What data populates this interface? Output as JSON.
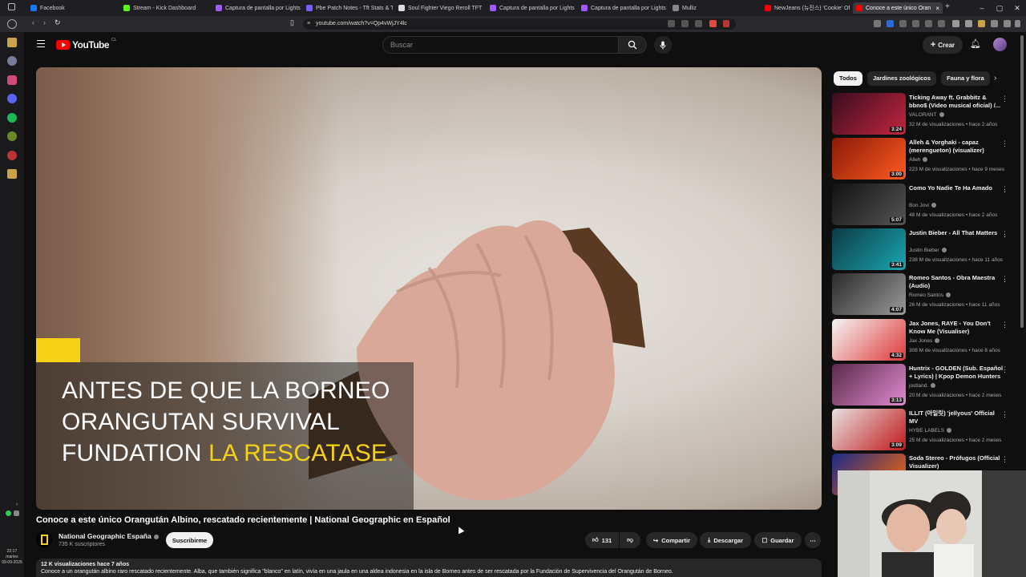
{
  "browser": {
    "tabs": [
      {
        "label": "Facebook",
        "color": "#1877f2"
      },
      {
        "label": "Stream - Kick Dashboard",
        "color": "#53fc18"
      },
      {
        "label": "Captura de pantalla por Lightshot",
        "color": "#a259ff"
      },
      {
        "label": "Pbe Patch Notes - Tft Stats & Too",
        "color": "#7b5cff"
      },
      {
        "label": "Soul Fighter Viego Reroll TFT Co",
        "color": "#dddddd"
      },
      {
        "label": "Captura de pantalla por Lightshot",
        "color": "#a259ff"
      },
      {
        "label": "Captura de pantalla por Lightshot",
        "color": "#a259ff"
      },
      {
        "label": "Mulliz",
        "color": "#888888"
      },
      {
        "label": "NewJeans (뉴진스) 'Cookie' Offici",
        "color": "#ff0000"
      },
      {
        "label": "Conoce a este único Oran",
        "color": "#ff0000",
        "active": true
      }
    ],
    "url": "youtube.com/watch?v=Qp4vWjJY4lc",
    "clock_time": "22:17",
    "clock_day": "martes",
    "clock_date": "09-09-2025"
  },
  "header": {
    "logo_text": "YouTube",
    "logo_region": "CL",
    "search_placeholder": "Buscar",
    "create_label": "Crear"
  },
  "video": {
    "caption_line1": "ANTES DE QUE LA BORNEO",
    "caption_line2": "ORANGUTAN SURVIVAL",
    "caption_line3_a": "FUNDATION ",
    "caption_line3_b": "LA RESCATASE.",
    "title": "Conoce a este único Orangután Albino, rescatado recientemente | National Geographic en Español",
    "channel_name": "National Geographic España",
    "subscribers": "735 K suscriptores",
    "subscribe_label": "Suscribirme",
    "likes": "131",
    "share_label": "Compartir",
    "download_label": "Descargar",
    "save_label": "Guardar",
    "views_age": "12 K visualizaciones  hace 7 años",
    "description": "Conoce a un orangután albino raro rescatado recientemente. Alba, que también significa \"blanco\" en latín, vivía en una jaula en una aldea indonesia en la isla de Borneo antes de ser rescatada por la Fundación de Supervivencia del Orangután de Borneo."
  },
  "chips": [
    "Todos",
    "Jardines zoológicos",
    "Fauna y flora"
  ],
  "recommendations": [
    {
      "title": "Ticking Away ft. Grabbitz & bbno$ (Video musical oficial) /...",
      "channel": "VALORANT",
      "stats": "32 M de visualizaciones • hace 2 años",
      "duration": "3:24",
      "c1": "#3a0d1e",
      "c2": "#c2253f"
    },
    {
      "title": "Alleh & Yorghaki - capaz (merengueton) (visualizer)",
      "channel": "Alleh",
      "stats": "223 M de visualizaciones • hace 9 meses",
      "duration": "3:00",
      "c1": "#8a1a08",
      "c2": "#ff5a1f"
    },
    {
      "title": "Como Yo Nadie Te Ha Amado",
      "channel": "Bon Jovi",
      "stats": "48 M de visualizaciones • hace 2 años",
      "duration": "5:07",
      "c1": "#111111",
      "c2": "#555555"
    },
    {
      "title": "Justin Bieber - All That Matters",
      "channel": "Justin Bieber",
      "stats": "238 M de visualizaciones • hace 11 años",
      "duration": "3:41",
      "c1": "#0b3a44",
      "c2": "#1aa6b0"
    },
    {
      "title": "Romeo Santos - Obra Maestra (Audio)",
      "channel": "Romeo Santos",
      "stats": "26 M de visualizaciones • hace 11 años",
      "duration": "4:07",
      "c1": "#2a2a2a",
      "c2": "#9a9a9a"
    },
    {
      "title": "Jax Jones, RAYE - You Don't Know Me (Visualiser)",
      "channel": "Jax Jones",
      "stats": "308 M de visualizaciones • hace 8 años",
      "duration": "4:32",
      "c1": "#f4f4f4",
      "c2": "#e03a3a"
    },
    {
      "title": "Huntrix - GOLDEN (Sub. Español + Lyrics) | Kpop Demon Hunters",
      "channel": "jostland.",
      "stats": "20 M de visualizaciones • hace 2 meses",
      "duration": "3:13",
      "c1": "#5a2a4a",
      "c2": "#e08ad0"
    },
    {
      "title": "ILLIT (아일릿) 'jellyous' Official MV",
      "channel": "HYBE LABELS",
      "stats": "25 M de visualizaciones • hace 2 meses",
      "duration": "3:09",
      "c1": "#e8e0e0",
      "c2": "#c01818"
    },
    {
      "title": "Soda Stereo - Prófugos (Official Visualizer)",
      "channel": "",
      "stats": "",
      "duration": "",
      "c1": "#1a2a8a",
      "c2": "#ff6a00"
    }
  ]
}
